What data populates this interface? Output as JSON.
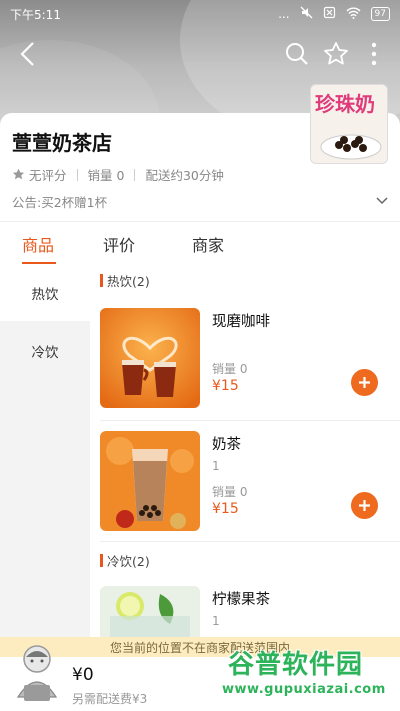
{
  "status_bar": {
    "time": "下午5:11",
    "signal": "...",
    "battery": "97"
  },
  "shop": {
    "name": "萱萱奶茶店",
    "rating": "无评分",
    "sales": "销量 0",
    "delivery": "配送约30分钟",
    "notice": "公告:买2杯赠1杯",
    "thumb_text": "珍珠奶"
  },
  "tabs": [
    {
      "label": "商品",
      "active": true
    },
    {
      "label": "评价",
      "active": false
    },
    {
      "label": "商家",
      "active": false
    }
  ],
  "categories": [
    {
      "label": "热饮",
      "active": true
    },
    {
      "label": "冷饮",
      "active": false
    }
  ],
  "sections": [
    {
      "title": "热饮(2)",
      "items": [
        {
          "name": "现磨咖啡",
          "desc": "",
          "sales": "销量 0",
          "price": "¥15"
        },
        {
          "name": "奶茶",
          "desc": "1",
          "sales": "销量 0",
          "price": "¥15"
        }
      ]
    },
    {
      "title": "冷饮(2)",
      "items": [
        {
          "name": "柠檬果茶",
          "desc": "1",
          "sales": "",
          "price": ""
        }
      ]
    }
  ],
  "delivery_notice": "您当前的位置不在商家配送范围内",
  "cart": {
    "total": "¥0",
    "fee": "另需配送费¥3"
  },
  "watermark": {
    "title": "谷普软件园",
    "url": "www.gupuxiazai.com"
  },
  "colors": {
    "accent": "#e8581a",
    "add_button": "#ee6a1e",
    "notice_bg": "#fcecbf"
  }
}
